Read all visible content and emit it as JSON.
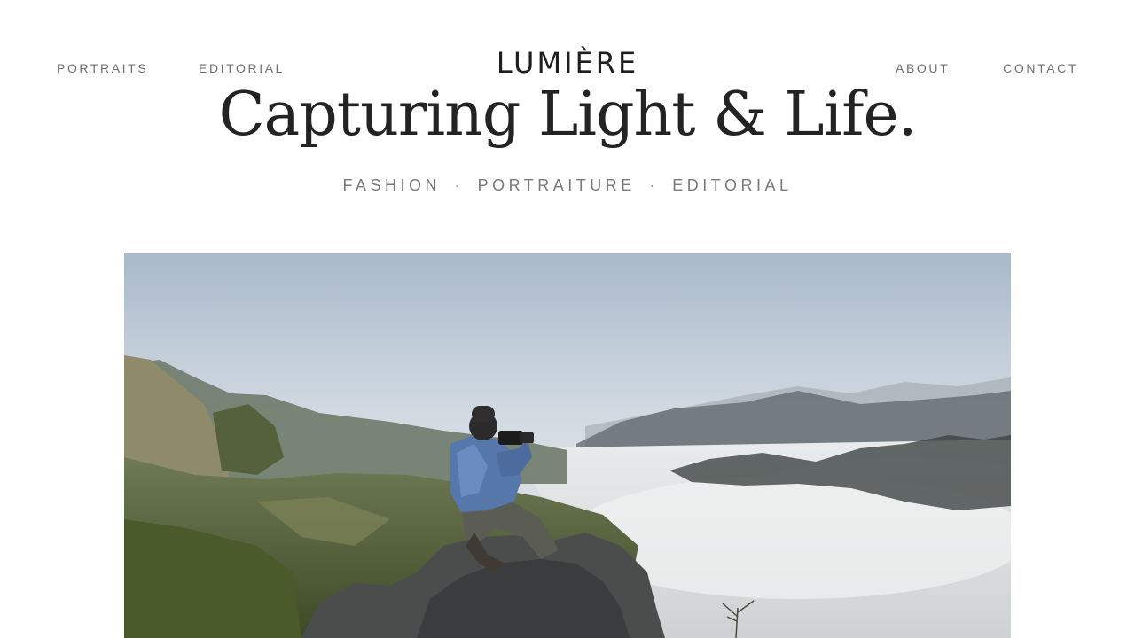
{
  "site": {
    "logo": "LUMIÈRE"
  },
  "nav": {
    "left": [
      {
        "label": "PORTRAITS"
      },
      {
        "label": "EDITORIAL"
      }
    ],
    "right": [
      {
        "label": "ABOUT"
      },
      {
        "label": "CONTACT"
      }
    ]
  },
  "hero": {
    "headline": "Capturing Light & Life.",
    "tags": [
      "FASHION",
      "PORTRAITURE",
      "EDITORIAL"
    ],
    "separator": "·"
  },
  "colors": {
    "text_dark": "#222222",
    "text_muted": "#6f6f6f",
    "background": "#ffffff"
  }
}
